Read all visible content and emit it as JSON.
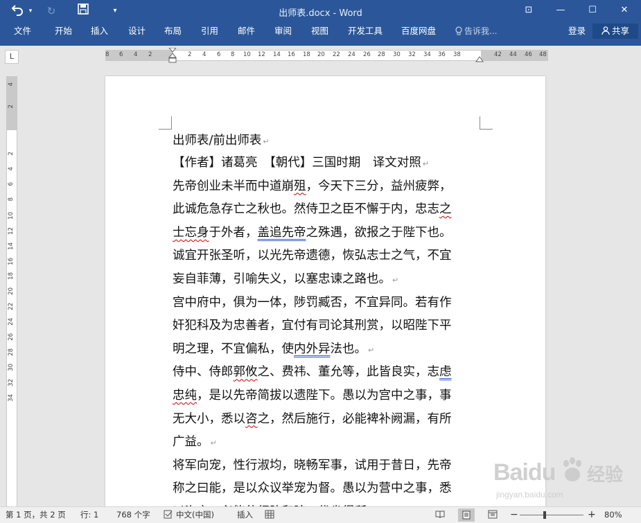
{
  "window": {
    "title": "出师表.docx - Word",
    "controls": {
      "ribbon_display": "⊡",
      "minimize": "—",
      "maximize": "☐",
      "close": "✕"
    }
  },
  "quick_access": {
    "undo_icon": "↶",
    "redo_icon": "↻",
    "save_icon": "floppy",
    "customize_icon": "▾"
  },
  "ribbon": {
    "tabs": [
      "文件",
      "开始",
      "插入",
      "设计",
      "布局",
      "引用",
      "邮件",
      "审阅",
      "视图",
      "开发工具",
      "百度网盘"
    ],
    "tell_me": "告诉我...",
    "sign_in": "登录",
    "share": "共享"
  },
  "ruler": {
    "corner": "L",
    "h_left": [
      "8",
      "6",
      "4",
      "2"
    ],
    "h_right": [
      "2",
      "4",
      "6",
      "8",
      "10",
      "12",
      "14",
      "16",
      "18",
      "20",
      "22",
      "24",
      "26",
      "28",
      "30",
      "32",
      "34",
      "36",
      "38"
    ],
    "h_margin_right": [
      "42",
      "44",
      "46",
      "48"
    ],
    "v_top": [
      "4",
      "2"
    ],
    "v_body": [
      "2",
      "4",
      "6",
      "8",
      "10",
      "12",
      "14",
      "16",
      "18",
      "20",
      "22",
      "24",
      "26",
      "28",
      "30",
      "32",
      "34"
    ]
  },
  "document": {
    "lines": [
      {
        "segments": [
          {
            "t": "出师表/前出师表"
          }
        ],
        "mark": "↵"
      },
      {
        "segments": [
          {
            "t": "【作者】诸葛亮　【朝代】三国时期　译文对照"
          }
        ],
        "mark": "↵"
      },
      {
        "segments": [
          {
            "t": "先帝创业未半而中道崩"
          },
          {
            "t": "殂",
            "s": "sq"
          },
          {
            "t": "，今天下三分，益州疲弊，"
          }
        ],
        "mark": ""
      },
      {
        "segments": [
          {
            "t": "此诚危急存亡之秋也。然侍卫之臣不懈于内，忠志"
          },
          {
            "t": "之",
            "s": "sq"
          }
        ],
        "mark": ""
      },
      {
        "segments": [
          {
            "t": "士忘身",
            "s": "sq"
          },
          {
            "t": "于外者，"
          },
          {
            "t": "盖追先帝",
            "s": "sqb"
          },
          {
            "t": "之殊遇，欲报之于陛下也。"
          }
        ],
        "mark": ""
      },
      {
        "segments": [
          {
            "t": "诚宜开张圣听，以光先帝遗德，恢弘志士之气，不宜"
          }
        ],
        "mark": ""
      },
      {
        "segments": [
          {
            "t": "妄自菲薄，引喻失义，以塞忠谏之路也。"
          }
        ],
        "mark": "↵"
      },
      {
        "segments": [
          {
            "t": "宫中府中，俱为一体，陟罚臧否，不宜异同。若有作"
          }
        ],
        "mark": ""
      },
      {
        "segments": [
          {
            "t": "奸犯科及为忠善者，宜付有司论其刑赏，以昭陛下平"
          }
        ],
        "mark": ""
      },
      {
        "segments": [
          {
            "t": "明之理，不宜偏私，使"
          },
          {
            "t": "内外异",
            "s": "sqb"
          },
          {
            "t": "法也。"
          }
        ],
        "mark": "↵"
      },
      {
        "segments": [
          {
            "t": "侍中、侍郎"
          },
          {
            "t": "郭攸",
            "s": "sq"
          },
          {
            "t": "之、费祎、董允等，此皆良实，志"
          },
          {
            "t": "虑",
            "s": "sqb"
          }
        ],
        "mark": ""
      },
      {
        "segments": [
          {
            "t": "忠纯",
            "s": "sq"
          },
          {
            "t": "，是以先帝简拔以遗陛下。愚以为宫中之事，事"
          }
        ],
        "mark": ""
      },
      {
        "segments": [
          {
            "t": "无大小，悉以"
          },
          {
            "t": "咨",
            "s": "sq"
          },
          {
            "t": "之，然后施行，必能裨补阙漏，有所"
          }
        ],
        "mark": ""
      },
      {
        "segments": [
          {
            "t": "广益。"
          }
        ],
        "mark": "↵"
      },
      {
        "segments": [
          {
            "t": "将军向宠，性行淑均，晓畅军事，试用于昔日，先帝"
          }
        ],
        "mark": ""
      },
      {
        "segments": [
          {
            "t": "称之曰能，是以众议举宠为督。愚以为营中之事，悉"
          }
        ],
        "mark": ""
      },
      {
        "segments": [
          {
            "t": "以咨之，必能使行阵和睦，优劣得所。"
          }
        ],
        "mark": ""
      }
    ]
  },
  "watermark": {
    "brand": "Baidu",
    "suffix": "经验",
    "url": "jingyan.baidu.com"
  },
  "status": {
    "page": "第 1 页，共 2 页",
    "line": "行: 1",
    "words": "768 个字",
    "language": "中文(中国)",
    "mode": "插入",
    "zoom": "80%",
    "zoom_minus": "−",
    "zoom_plus": "+",
    "zoom_level": 0.8
  }
}
